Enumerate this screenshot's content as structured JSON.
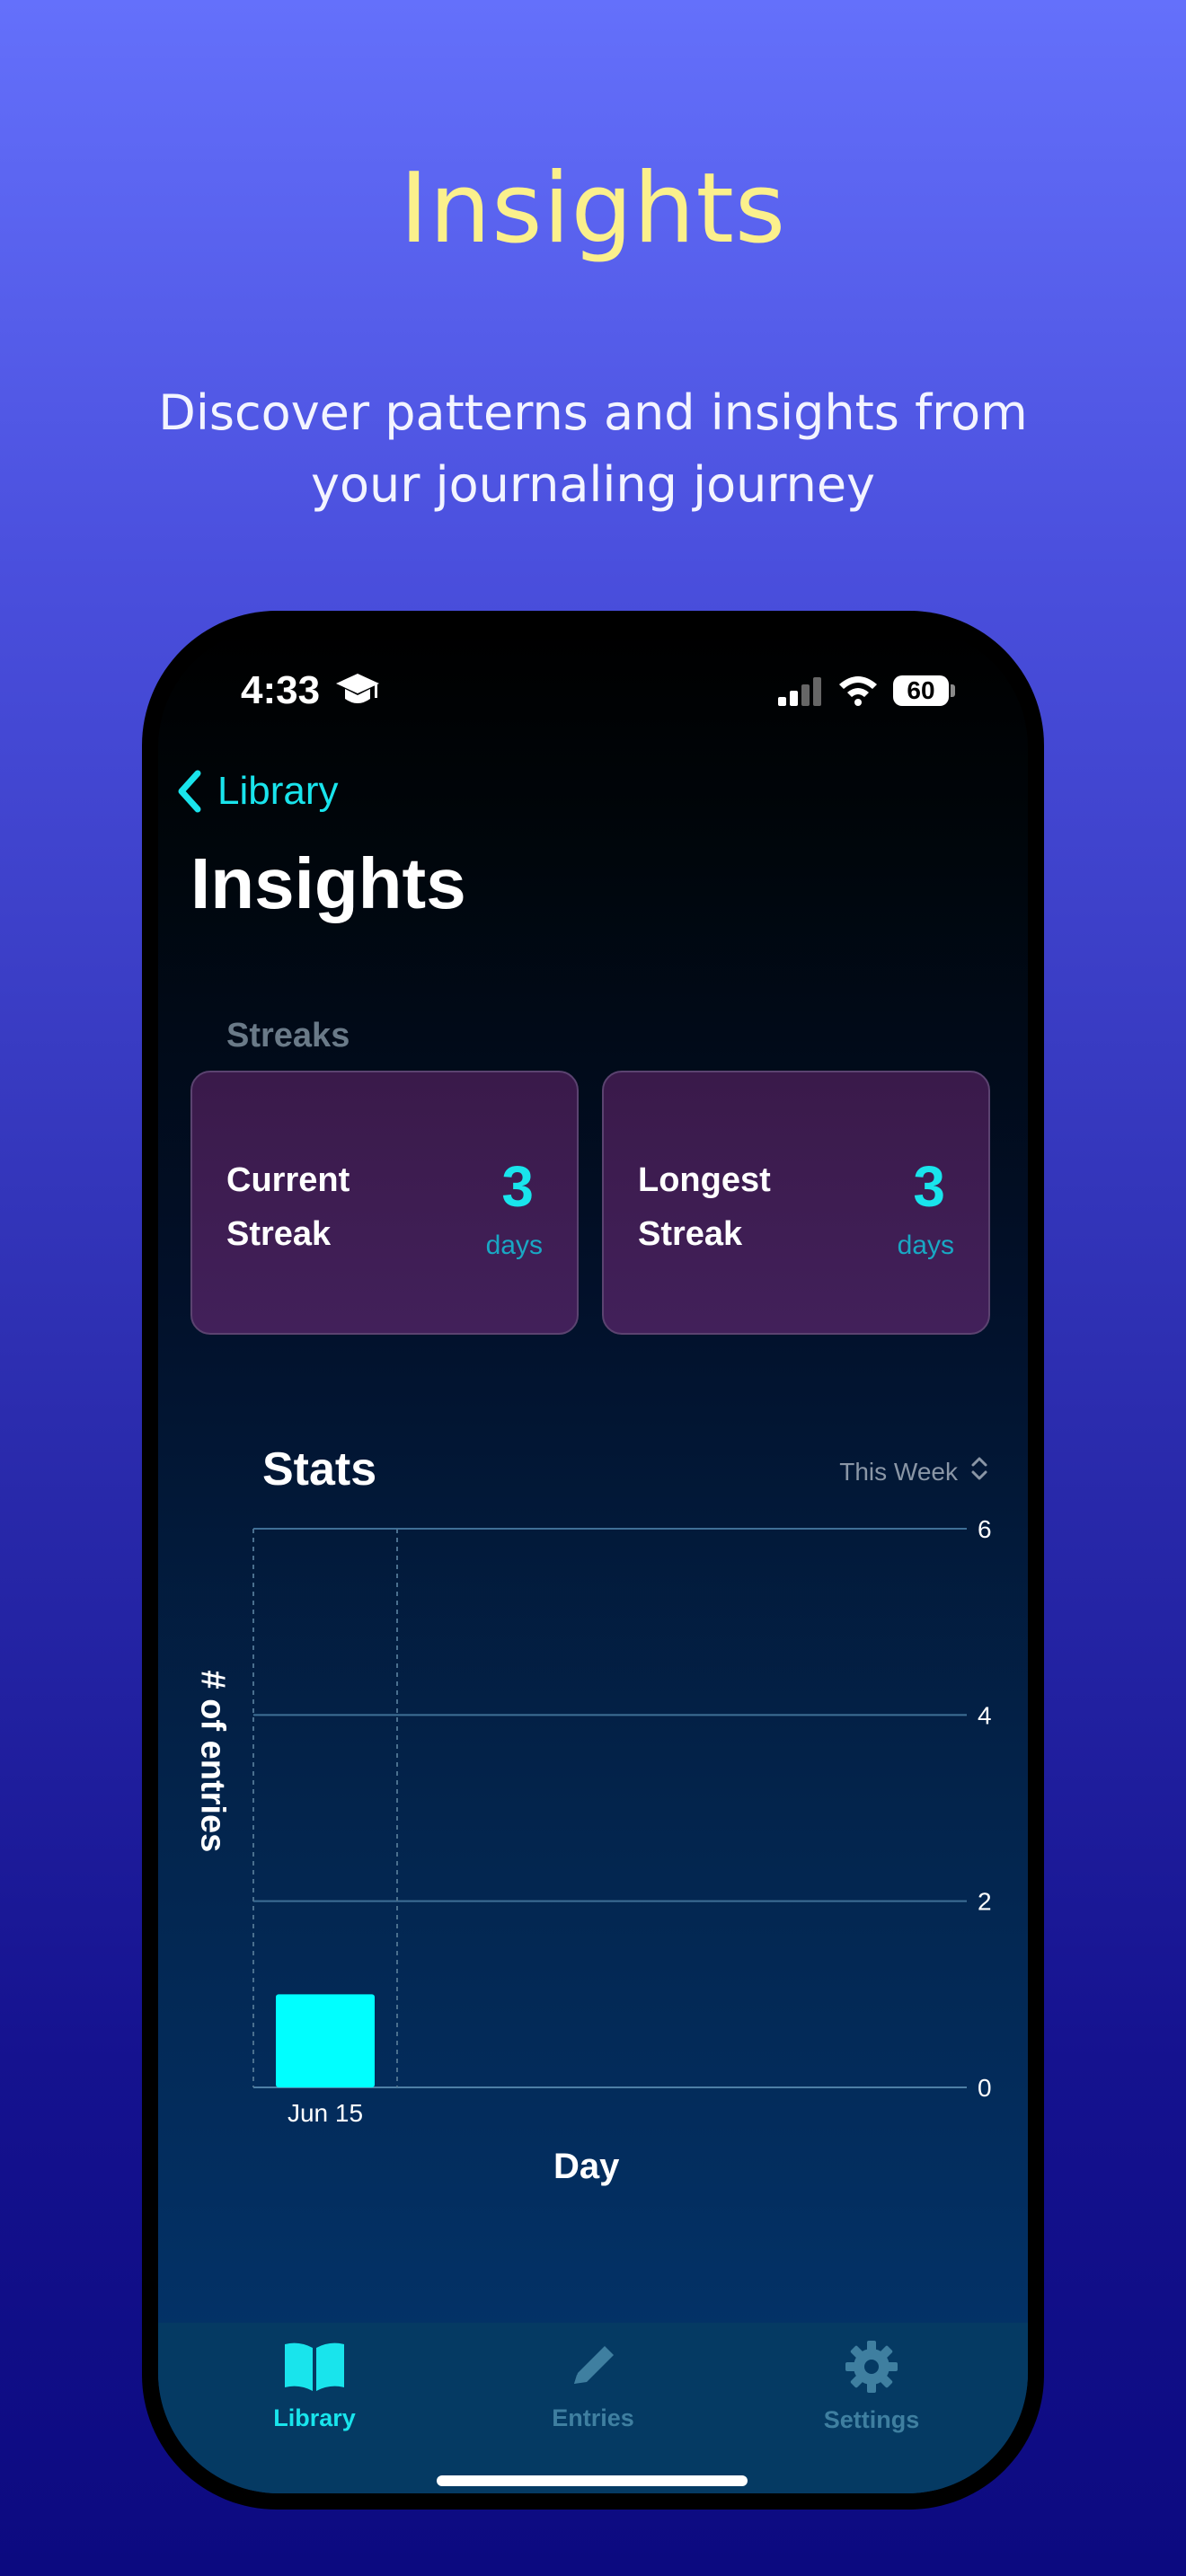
{
  "hero": {
    "title": "Insights",
    "subtitle": "Discover patterns and insights from your journaling journey"
  },
  "status_bar": {
    "time": "4:33",
    "battery": "60"
  },
  "nav": {
    "back_label": "Library",
    "title": "Insights"
  },
  "streaks": {
    "section_label": "Streaks",
    "current": {
      "label": "Current Streak",
      "value": "3",
      "unit": "days"
    },
    "longest": {
      "label": "Longest Streak",
      "value": "3",
      "unit": "days"
    }
  },
  "stats": {
    "title": "Stats",
    "range_label": "This Week"
  },
  "chart_data": {
    "type": "bar",
    "categories": [
      "Jun 15"
    ],
    "values": [
      1
    ],
    "xlabel": "Day",
    "ylabel": "# of entries",
    "ylim": [
      0,
      6
    ],
    "yticks": [
      0,
      2,
      4,
      6
    ],
    "grid": true,
    "color": "#00ffff"
  },
  "tabs": [
    {
      "label": "Library",
      "icon": "book-icon",
      "active": true
    },
    {
      "label": "Entries",
      "icon": "pencil-icon",
      "active": false
    },
    {
      "label": "Settings",
      "icon": "gear-icon",
      "active": false
    }
  ],
  "colors": {
    "accent": "#19e4ec",
    "inactive_tab": "#3f7fa0",
    "hero_title": "#fbf08c"
  }
}
